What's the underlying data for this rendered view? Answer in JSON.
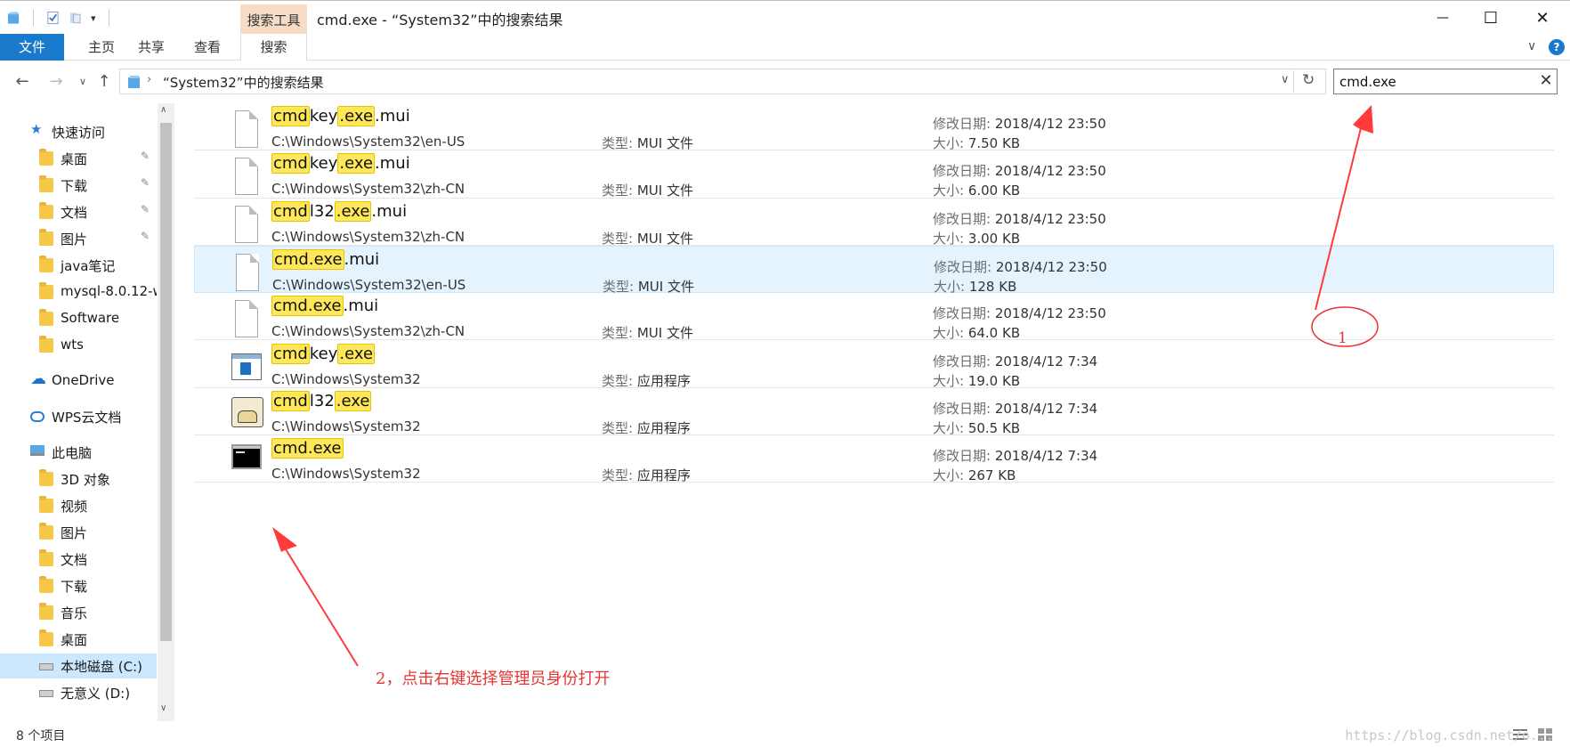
{
  "titlebar": {
    "context_tab": "搜索工具",
    "title": "cmd.exe - “System32”中的搜索结果",
    "minimize": "—",
    "maximize": "☐",
    "close": "✕"
  },
  "ribbon": {
    "tabs": [
      "文件",
      "主页",
      "共享",
      "查看",
      "搜索"
    ],
    "expand": "∨",
    "help": "?"
  },
  "address": {
    "breadcrumb": "“System32”中的搜索结果",
    "search_value": "cmd.exe",
    "clear": "✕"
  },
  "sidebar": {
    "items": [
      {
        "label": "快速访问",
        "icon": "star-icon"
      },
      {
        "label": "桌面",
        "icon": "desktop-folder-icon",
        "pinned": true
      },
      {
        "label": "下载",
        "icon": "download-folder-icon",
        "pinned": true
      },
      {
        "label": "文档",
        "icon": "documents-folder-icon",
        "pinned": true
      },
      {
        "label": "图片",
        "icon": "pictures-folder-icon",
        "pinned": true
      },
      {
        "label": "java笔记",
        "icon": "folder-icon"
      },
      {
        "label": "mysql-8.0.12-w",
        "icon": "folder-icon"
      },
      {
        "label": "Software",
        "icon": "folder-icon"
      },
      {
        "label": "wts",
        "icon": "folder-icon"
      },
      {
        "label": "OneDrive",
        "icon": "cloud-icon"
      },
      {
        "label": "WPS云文档",
        "icon": "wps-cloud-icon"
      },
      {
        "label": "此电脑",
        "icon": "computer-icon"
      },
      {
        "label": "3D 对象",
        "icon": "3d-folder-icon"
      },
      {
        "label": "视频",
        "icon": "video-folder-icon"
      },
      {
        "label": "图片",
        "icon": "pictures-folder-icon"
      },
      {
        "label": "文档",
        "icon": "documents-folder-icon"
      },
      {
        "label": "下载",
        "icon": "download-folder-icon"
      },
      {
        "label": "音乐",
        "icon": "music-folder-icon"
      },
      {
        "label": "桌面",
        "icon": "desktop-folder-icon"
      },
      {
        "label": "本地磁盘 (C:)",
        "icon": "drive-icon",
        "selected": true
      },
      {
        "label": "无意义 (D:)",
        "icon": "drive-icon"
      }
    ]
  },
  "labels": {
    "type": "类型:",
    "modified": "修改日期:",
    "size": "大小:"
  },
  "files": [
    {
      "parts": [
        [
          "cmd",
          true
        ],
        [
          "key",
          false
        ],
        [
          ".exe",
          true
        ],
        [
          ".mui",
          false
        ]
      ],
      "path": "C:\\Windows\\System32\\en-US",
      "type": "MUI 文件",
      "date": "2018/4/12 23:50",
      "size": "7.50 KB",
      "icon": "document-icon"
    },
    {
      "parts": [
        [
          "cmd",
          true
        ],
        [
          "key",
          false
        ],
        [
          ".exe",
          true
        ],
        [
          ".mui",
          false
        ]
      ],
      "path": "C:\\Windows\\System32\\zh-CN",
      "type": "MUI 文件",
      "date": "2018/4/12 23:50",
      "size": "6.00 KB",
      "icon": "document-icon"
    },
    {
      "parts": [
        [
          "cmd",
          true
        ],
        [
          "l32",
          false
        ],
        [
          ".exe",
          true
        ],
        [
          ".mui",
          false
        ]
      ],
      "path": "C:\\Windows\\System32\\zh-CN",
      "type": "MUI 文件",
      "date": "2018/4/12 23:50",
      "size": "3.00 KB",
      "icon": "document-icon"
    },
    {
      "parts": [
        [
          "cmd.exe",
          true
        ],
        [
          ".mui",
          false
        ]
      ],
      "path": "C:\\Windows\\System32\\en-US",
      "type": "MUI 文件",
      "date": "2018/4/12 23:50",
      "size": "128 KB",
      "icon": "document-icon",
      "selected": true
    },
    {
      "parts": [
        [
          "cmd.exe",
          true
        ],
        [
          ".mui",
          false
        ]
      ],
      "path": "C:\\Windows\\System32\\zh-CN",
      "type": "MUI 文件",
      "date": "2018/4/12 23:50",
      "size": "64.0 KB",
      "icon": "document-icon"
    },
    {
      "parts": [
        [
          "cmd",
          true
        ],
        [
          "key",
          false
        ],
        [
          ".exe",
          true
        ]
      ],
      "path": "C:\\Windows\\System32",
      "type": "应用程序",
      "date": "2018/4/12 7:34",
      "size": "19.0 KB",
      "icon": "app-window-icon"
    },
    {
      "parts": [
        [
          "cmd",
          true
        ],
        [
          "l32",
          false
        ],
        [
          ".exe",
          true
        ]
      ],
      "path": "C:\\Windows\\System32",
      "type": "应用程序",
      "date": "2018/4/12 7:34",
      "size": "50.5 KB",
      "icon": "phone-dialer-icon"
    },
    {
      "parts": [
        [
          "cmd.exe",
          true
        ]
      ],
      "path": "C:\\Windows\\System32",
      "type": "应用程序",
      "date": "2018/4/12 7:34",
      "size": "267 KB",
      "icon": "console-icon"
    }
  ],
  "status": {
    "count": "8 个项目"
  },
  "annotations": {
    "circle_label": "1",
    "instruction": "2，点击右键选择管理员身份打开",
    "watermark": "https://blog.csdn.net/o..."
  },
  "colors": {
    "accent": "#1979ca",
    "highlight": "#ffe75a",
    "selection": "#e5f3ff",
    "annotation": "#e53535",
    "context_tab": "#f6dcc6"
  }
}
